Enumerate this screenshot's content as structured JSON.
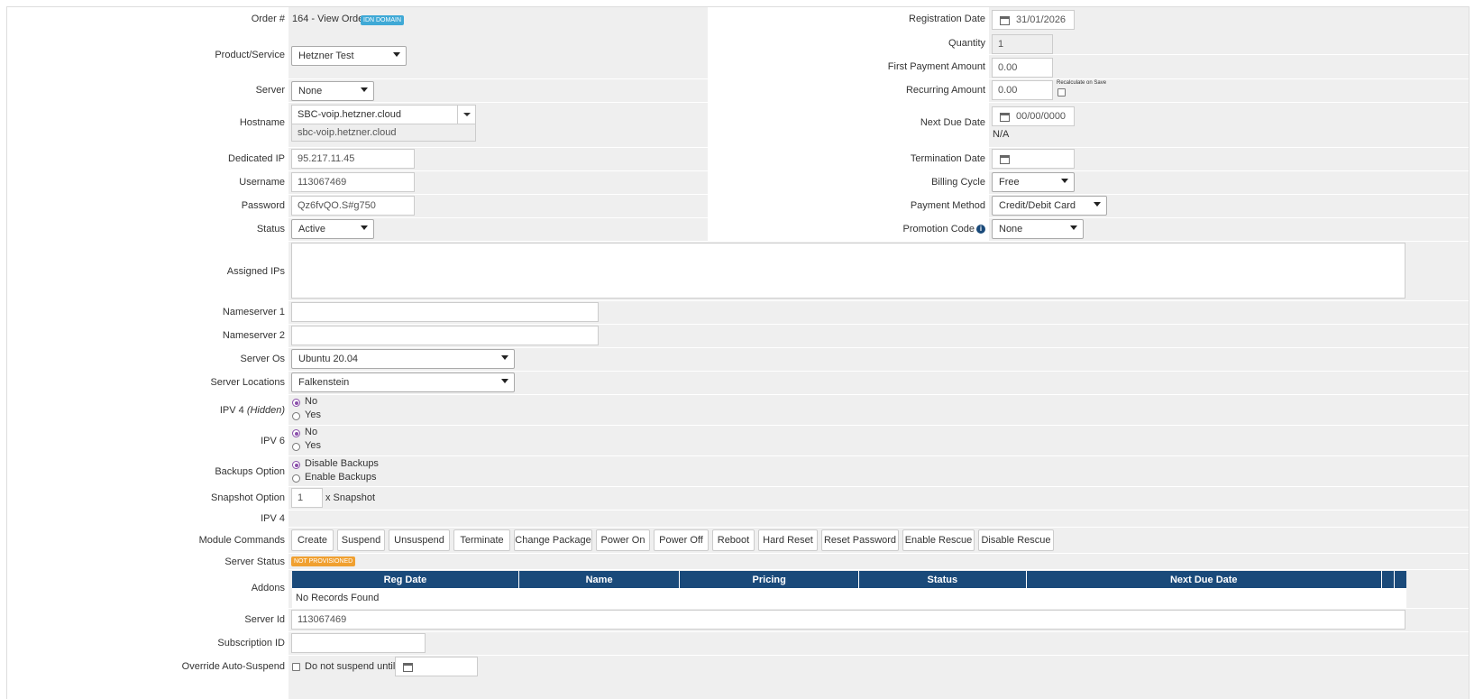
{
  "left": {
    "order": {
      "label": "Order #",
      "value": "164 - View Order",
      "badge": "IDN DOMAIN"
    },
    "product": {
      "label": "Product/Service",
      "value": "Hetzner Test"
    },
    "server": {
      "label": "Server",
      "value": "None"
    },
    "hostname": {
      "label": "Hostname",
      "value": "SBC-voip.hetzner.cloud",
      "sub": "sbc-voip.hetzner.cloud"
    },
    "dedicated_ip": {
      "label": "Dedicated IP",
      "value": "95.217.11.45"
    },
    "username": {
      "label": "Username",
      "value": "113067469"
    },
    "password": {
      "label": "Password",
      "value": "Qz6fvQO.S#g750"
    },
    "status": {
      "label": "Status",
      "value": "Active"
    }
  },
  "right": {
    "registration_date": {
      "label": "Registration Date",
      "value": "31/01/2026"
    },
    "quantity": {
      "label": "Quantity",
      "value": "1"
    },
    "first_payment": {
      "label": "First Payment Amount",
      "value": "0.00"
    },
    "recurring": {
      "label": "Recurring Amount",
      "value": "0.00",
      "recalc": "Recalculate on Save"
    },
    "next_due": {
      "label": "Next Due Date",
      "value": "00/00/0000",
      "na": "N/A"
    },
    "termination": {
      "label": "Termination Date",
      "value": ""
    },
    "billing_cycle": {
      "label": "Billing Cycle",
      "value": "Free"
    },
    "payment_method": {
      "label": "Payment Method",
      "value": "Credit/Debit Card"
    },
    "promotion": {
      "label": "Promotion Code",
      "value": "None"
    }
  },
  "assigned_ips": {
    "label": "Assigned IPs",
    "value": ""
  },
  "ns1": {
    "label": "Nameserver 1",
    "value": ""
  },
  "ns2": {
    "label": "Nameserver 2",
    "value": ""
  },
  "server_os": {
    "label": "Server Os",
    "value": "Ubuntu 20.04"
  },
  "server_locations": {
    "label": "Server Locations",
    "value": "Falkenstein"
  },
  "ipv4_hidden": {
    "label": "IPV 4",
    "label_em": "(Hidden)",
    "options": [
      "No",
      "Yes"
    ],
    "selected": "No"
  },
  "ipv6": {
    "label": "IPV 6",
    "options": [
      "No",
      "Yes"
    ],
    "selected": "No"
  },
  "backups": {
    "label": "Backups Option",
    "options": [
      "Disable Backups",
      "Enable Backups"
    ],
    "selected": "Disable Backups"
  },
  "snapshot": {
    "label": "Snapshot Option",
    "value": "1",
    "suffix": "x Snapshot"
  },
  "ipv4": {
    "label": "IPV 4"
  },
  "module_commands": {
    "label": "Module Commands",
    "buttons": [
      "Create",
      "Suspend",
      "Unsuspend",
      "Terminate",
      "Change Package",
      "Power On",
      "Power Off",
      "Reboot",
      "Hard Reset",
      "Reset Password",
      "Enable Rescue",
      "Disable Rescue"
    ]
  },
  "server_status": {
    "label": "Server Status",
    "badge": "NOT PROVISIONED"
  },
  "addons": {
    "label": "Addons",
    "columns": [
      "Reg Date",
      "Name",
      "Pricing",
      "Status",
      "Next Due Date"
    ],
    "empty": "No Records Found"
  },
  "server_id": {
    "label": "Server Id",
    "value": "113067469"
  },
  "subscription_id": {
    "label": "Subscription ID",
    "value": ""
  },
  "override": {
    "label": "Override Auto-Suspend",
    "checkbox_label": "Do not suspend until"
  },
  "colors": {
    "accent": "#8a4faa",
    "table_header": "#1a4a7a",
    "badge_info": "#3fa9d6",
    "badge_warn": "#f0a030"
  }
}
